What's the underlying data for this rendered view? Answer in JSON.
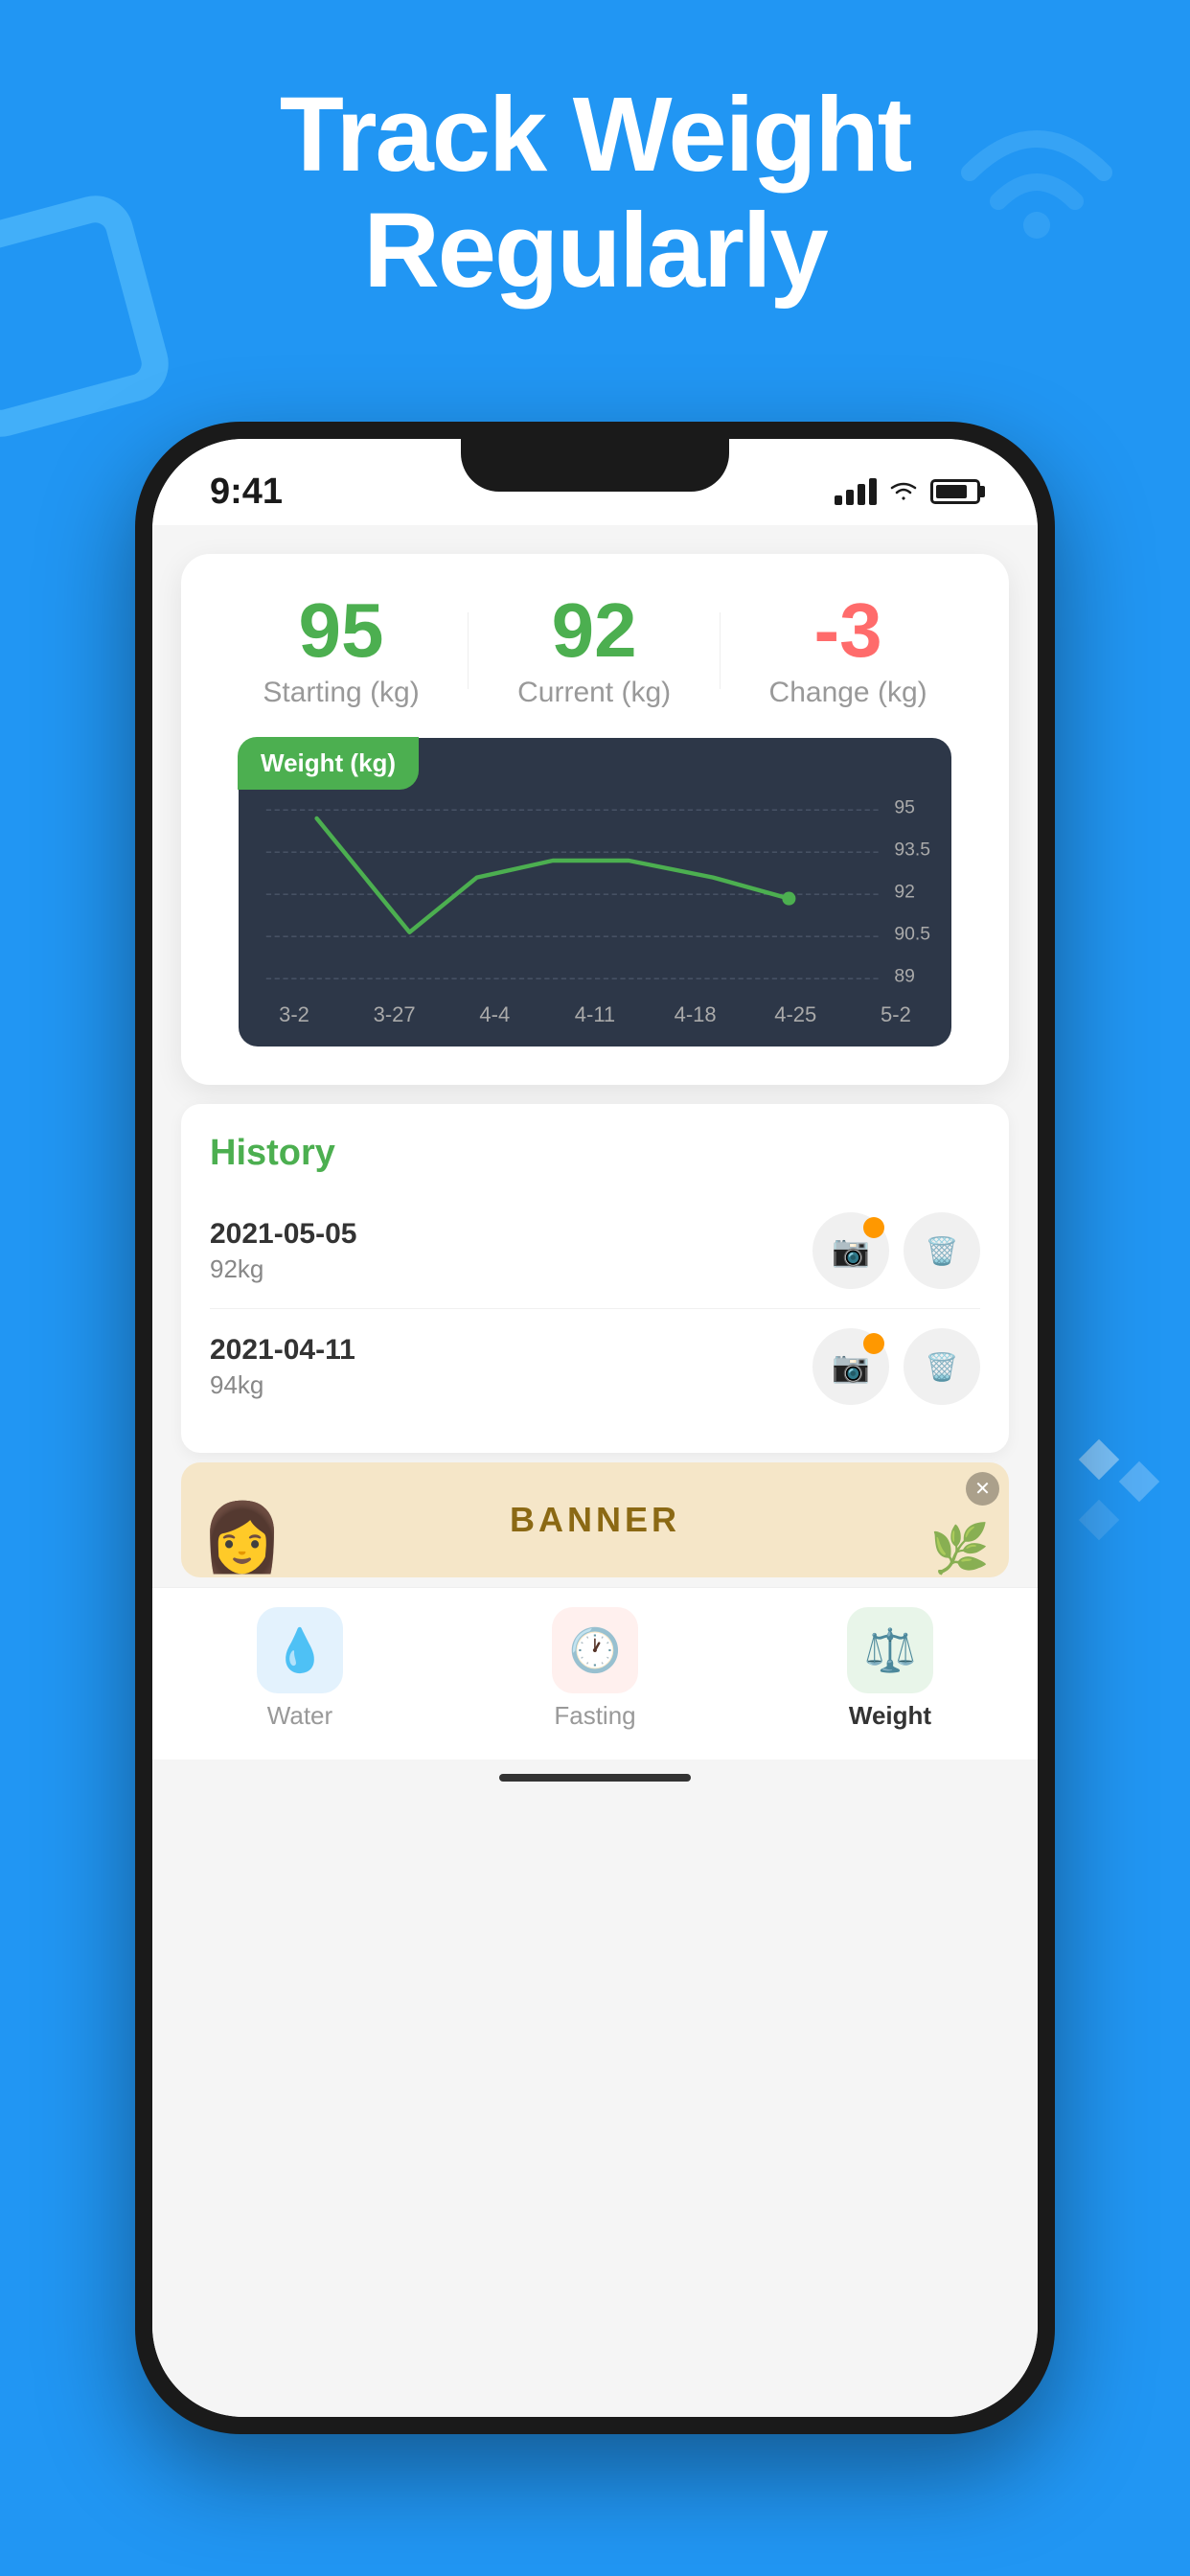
{
  "header": {
    "title_line1": "Track Weight",
    "title_line2": "Regularly"
  },
  "status_bar": {
    "time": "9:41",
    "signal": "signal",
    "wifi": "wifi",
    "battery": "battery"
  },
  "stats": {
    "starting_value": "95",
    "starting_label": "Starting (kg)",
    "current_value": "92",
    "current_label": "Current (kg)",
    "change_value": "-3",
    "change_label": "Change (kg)"
  },
  "chart": {
    "title": "Weight",
    "unit": "(kg)",
    "y_labels": [
      "95",
      "93.5",
      "92",
      "90.5",
      "89"
    ],
    "x_labels": [
      "3-2",
      "3-27",
      "4-4",
      "4-11",
      "4-18",
      "4-25",
      "5-2"
    ]
  },
  "history": {
    "title": "History",
    "items": [
      {
        "date": "2021-05-05",
        "weight": "92kg"
      },
      {
        "date": "2021-04-11",
        "weight": "94kg"
      }
    ]
  },
  "banner": {
    "text": "BANNER"
  },
  "bottom_nav": {
    "items": [
      {
        "label": "Water",
        "active": false,
        "icon": "💧",
        "bg": "blue-bg"
      },
      {
        "label": "Fasting",
        "active": false,
        "icon": "🕐",
        "bg": "red-bg"
      },
      {
        "label": "Weight",
        "active": true,
        "icon": "⚖️",
        "bg": "green-bg"
      }
    ]
  }
}
